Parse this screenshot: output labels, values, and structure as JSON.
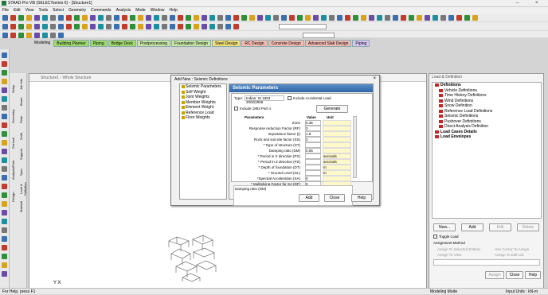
{
  "app": {
    "title": "STAAD.Pro V8i (SELECTseries 6) - [Structure1]"
  },
  "menu": [
    "File",
    "Edit",
    "View",
    "Tools",
    "Select",
    "Geometry",
    "Commands",
    "Analysis",
    "Mode",
    "Window",
    "Help"
  ],
  "toolbar": {
    "load_combo": "",
    "view_combo": ""
  },
  "pagecontrol": {
    "label": "Modeling",
    "tabs": [
      {
        "label": "Building Planner",
        "color": "#9fd96a"
      },
      {
        "label": "Piping",
        "color": "#9fd96a"
      },
      {
        "label": "Bridge Deck",
        "color": "#9fd96a"
      },
      {
        "label": "Postprocessing",
        "color": "#c9e7a4"
      },
      {
        "label": "Foundation Design",
        "color": "#c9e7a4"
      },
      {
        "label": "Steel Design",
        "color": "#f3e07a"
      },
      {
        "label": "RC Design",
        "color": "#f4b9b0"
      },
      {
        "label": "Concrete Design",
        "color": "#f4b9b0"
      },
      {
        "label": "Advanced Slab Design",
        "color": "#f4b9b0"
      },
      {
        "label": "Piping",
        "color": "#d7c4f4"
      }
    ]
  },
  "vtabs": {
    "outer": [
      "Setup",
      "Geometry",
      "General",
      "Analysis/Print",
      "Design"
    ],
    "inner": [
      "Job Info",
      "Beam",
      "Plate",
      "Solid",
      "Support",
      "Spec",
      "Load & Definition",
      "Material"
    ]
  },
  "mainview": {
    "title": "Structure1 - Whole Structure",
    "axis": "Y X"
  },
  "dialog": {
    "title": "Add New : Seismic Definitions",
    "close": "×",
    "tree": [
      "Seismic Parameters",
      "Self Weight",
      "Joint Weights",
      "Member Weights",
      "Element Weight",
      "Reference Load",
      "Floor Weights"
    ],
    "panel_title": "Seismic Parameters",
    "type_label": "Type:",
    "type_value": "Indian: IS 1893 : 2002/2005",
    "accidental": "Include Accidental Load",
    "include_part4": "Include 1893 Part 4",
    "generate": "Generate",
    "columns": [
      "Parameters",
      "Value",
      "Unit"
    ],
    "params": [
      {
        "name": "Zone",
        "value": "0.36",
        "unit": ""
      },
      {
        "name": "Response reduction Factor (RF)",
        "value": "3",
        "unit": ""
      },
      {
        "name": "Importance factor (I)",
        "value": "1.5",
        "unit": ""
      },
      {
        "name": "Rock and soil site factor (SS)",
        "value": "2",
        "unit": ""
      },
      {
        "name": "* Type of structure (ST)",
        "value": "",
        "unit": ""
      },
      {
        "name": "Damping ratio (DM)",
        "value": "0.05",
        "unit": ""
      },
      {
        "name": "* Period in X direction (PX)",
        "value": "",
        "unit": "seconds"
      },
      {
        "name": "* Period in Z direction (PZ)",
        "value": "",
        "unit": "seconds"
      },
      {
        "name": "* Depth of foundation (DT)",
        "value": "",
        "unit": "m"
      },
      {
        "name": "* Ground Level (GL)",
        "value": "",
        "unit": "m"
      },
      {
        "name": "*Spectral Acceleration (SA)",
        "value": "0",
        "unit": ""
      },
      {
        "name": "* Multiplying Factor for SA (DF)",
        "value": "0",
        "unit": ""
      }
    ],
    "description": "Damping ratio (DM)",
    "buttons": {
      "add": "Add",
      "close": "Close",
      "help": "Help"
    }
  },
  "rightpanel": {
    "title": "Load & Definition",
    "tree": [
      {
        "label": "Definitions",
        "level": 0
      },
      {
        "label": "Vehicle Definitions",
        "level": 1
      },
      {
        "label": "Time History Definitions",
        "level": 1
      },
      {
        "label": "Wind Definitions",
        "level": 1
      },
      {
        "label": "Snow Definition",
        "level": 1
      },
      {
        "label": "Reference Load Definitions",
        "level": 1
      },
      {
        "label": "Seismic Definitions",
        "level": 1
      },
      {
        "label": "Pushover Definitions",
        "level": 1
      },
      {
        "label": "Direct Analysis Definition",
        "level": 1
      },
      {
        "label": "Load Cases Details",
        "level": 0
      },
      {
        "label": "Load Envelopes",
        "level": 0
      }
    ],
    "btns": {
      "new": "New...",
      "add": "Add",
      "edit": "Edit",
      "delete": "Delete"
    },
    "toggle": "Toggle Load",
    "assign_label": "Assignment Method",
    "assign_opts": [
      "Assign To Selected Entities",
      "Use Cursor To Assign",
      "Assign To View",
      "Assign To Edit List"
    ],
    "bottom": {
      "assign": "Assign",
      "close": "Close",
      "help": "Help"
    }
  },
  "status": {
    "left": "For Help, press F1",
    "mid": "Modeling Mode",
    "right": "Input Units : kN-m"
  }
}
